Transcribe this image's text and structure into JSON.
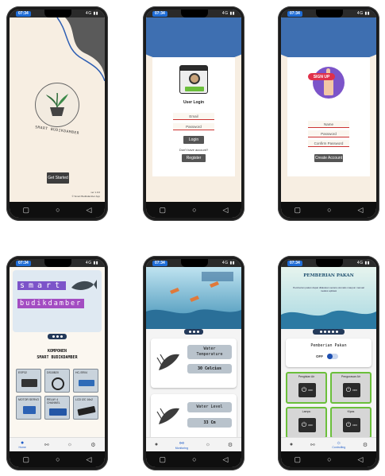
{
  "status": {
    "time": "07:34",
    "signal": "4G ▮▮"
  },
  "nav": {
    "square": "▢",
    "circle": "○",
    "back": "◁"
  },
  "splash": {
    "brand": "SMART BUDIKDAMBER",
    "get_started": "Get Started",
    "version": "ver 1.0.0",
    "footer": "© Smart Budikdamber App"
  },
  "login": {
    "title": "User Login",
    "email_placeholder": "Email",
    "password_placeholder": "Password",
    "login_button": "Login",
    "no_account": "Don't have account?",
    "register_button": "Register"
  },
  "signup": {
    "badge": "SIGN UP",
    "name_placeholder": "Name",
    "password_placeholder": "Password",
    "confirm_placeholder": "Confirm Password",
    "create_button": "Create Account"
  },
  "home": {
    "banner_line1": "smart",
    "banner_line2": "budikdamber",
    "section_title_1": "KOMPONEN",
    "section_title_2": "SMART BUDIKDAMBER",
    "components": [
      {
        "label": "ESP32"
      },
      {
        "label": "DS18B20"
      },
      {
        "label": "HC-SR04"
      },
      {
        "label": "MOTOR SERVO"
      },
      {
        "label": "RELAY 4 CHANNEL"
      },
      {
        "label": "LCD I2C 16x2"
      }
    ],
    "nav_home": "Home"
  },
  "monitoring": {
    "temp_label_1": "Water",
    "temp_label_2": "Temperature",
    "temp_value": "30 Celcius",
    "level_label": "Water Level",
    "level_value": "33 Cm",
    "nav_label": "Monitoring"
  },
  "control": {
    "header_title": "PEMBERIAN PAKAN",
    "header_text": "Pemberian pakan dapat dilakukan secara otomatis maupun manual melalui aplikasi",
    "feed_label": "Pemberian Pakan",
    "toggle_state": "OFF",
    "pump_in": "Pengisian Air",
    "pump_out": "Pengurasan Air",
    "lamp": "Lampu",
    "heater": "Kipas",
    "off": "OFF",
    "nav_label": "Controlling"
  },
  "colors": {
    "accent_blue": "#3e6fb1",
    "green_border": "#6bbf3b",
    "button_dark": "#3d3d3d",
    "banner_purple": "#7c54c9"
  }
}
